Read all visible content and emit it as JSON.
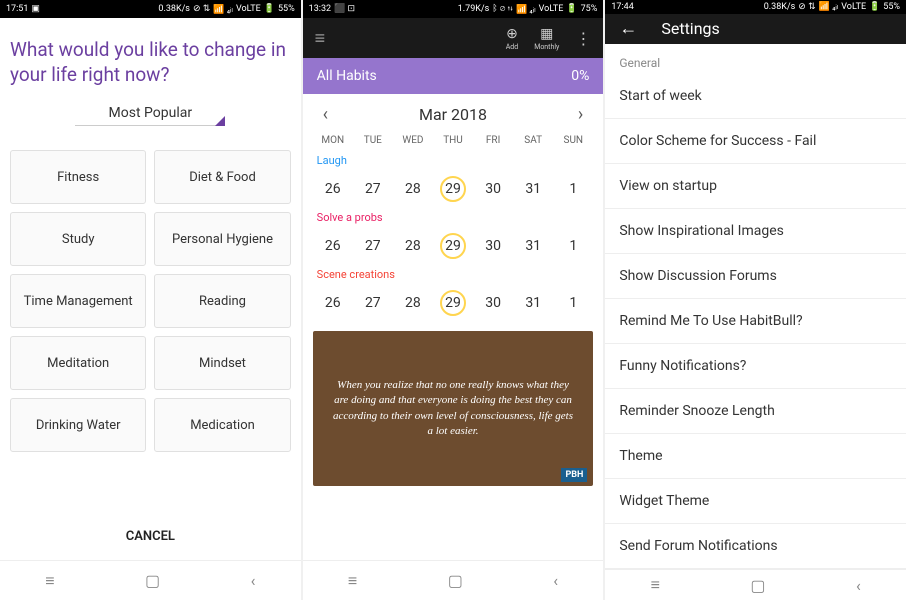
{
  "screen1": {
    "status": {
      "time": "17:51",
      "speed": "0.38K/s",
      "signal": "VoLTE",
      "battery": "55%"
    },
    "title": "What would you like to change in your life right now?",
    "dropdown": "Most Popular",
    "categories": [
      "Fitness",
      "Diet & Food",
      "Study",
      "Personal Hygiene",
      "Time Management",
      "Reading",
      "Meditation",
      "Mindset",
      "Drinking Water",
      "Medication"
    ],
    "cancel": "CANCEL"
  },
  "screen2": {
    "status": {
      "time": "13:32",
      "speed": "1.79K/s",
      "signal": "VoLTE",
      "battery": "75%"
    },
    "actions": {
      "add": "Add",
      "monthly": "Monthly"
    },
    "habitsBar": {
      "label": "All Habits",
      "percent": "0%"
    },
    "month": "Mar 2018",
    "dayHeaders": [
      "MON",
      "TUE",
      "WED",
      "THU",
      "FRI",
      "SAT",
      "SUN"
    ],
    "habits": [
      {
        "name": "Laugh",
        "class": "laugh",
        "days": [
          "26",
          "27",
          "28",
          "29",
          "30",
          "31",
          "1"
        ],
        "today": 3
      },
      {
        "name": "Solve a probs",
        "class": "solve",
        "days": [
          "26",
          "27",
          "28",
          "29",
          "30",
          "31",
          "1"
        ],
        "today": 3
      },
      {
        "name": "Scene creations",
        "class": "scene",
        "days": [
          "26",
          "27",
          "28",
          "29",
          "30",
          "31",
          "1"
        ],
        "today": 3
      }
    ],
    "quote": "When you realize that no one really knows what they are doing and that everyone is doing the best they can according to their own level of consciousness, life gets a lot easier.",
    "pbh": "PBH"
  },
  "screen3": {
    "status": {
      "time": "17:44",
      "speed": "0.38K/s",
      "signal": "VoLTE",
      "battery": "55%"
    },
    "title": "Settings",
    "section": "General",
    "items": [
      "Start of week",
      "Color Scheme for Success - Fail",
      "View on startup",
      "Show Inspirational Images",
      "Show Discussion Forums",
      "Remind Me To Use HabitBull?",
      "Funny Notifications?",
      "Reminder Snooze Length",
      "Theme",
      "Widget Theme",
      "Send Forum Notifications"
    ]
  }
}
